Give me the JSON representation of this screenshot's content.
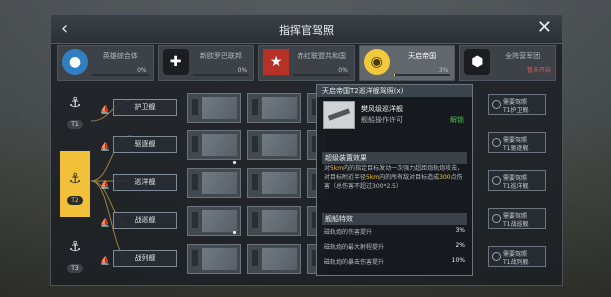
{
  "header": {
    "title": "指挥官驾照",
    "back_icon": "‹",
    "close_icon": "✕"
  },
  "tabs": [
    {
      "name": "英雄综合体",
      "pct": "0%",
      "icon": "●",
      "icon_name": "blue-circle-icon",
      "color": "blue",
      "active": false
    },
    {
      "name": "新欧罗巴联邦",
      "pct": "0%",
      "icon": "✚",
      "icon_name": "cross-emblem-icon",
      "color": "dark",
      "active": false
    },
    {
      "name": "赤红联盟共和国",
      "pct": "0%",
      "icon": "★",
      "icon_name": "red-star-icon",
      "color": "red",
      "active": false
    },
    {
      "name": "天启帝国",
      "pct": "3%",
      "fill": 0.03,
      "icon": "◉",
      "icon_name": "gold-emblem-icon",
      "color": "gold",
      "active": true
    },
    {
      "name": "全阵营军团",
      "pct": "0%",
      "icon": "⬢",
      "icon_name": "hex-emblem-icon",
      "color": "dark",
      "active": false,
      "lock": "暂未开启"
    }
  ],
  "tiers": [
    {
      "label": "T1",
      "icon": "⚓"
    },
    {
      "label": "T2",
      "icon": "⚓",
      "active": true
    },
    {
      "label": "T3",
      "icon": "⚓"
    }
  ],
  "ships": [
    "护卫舰",
    "驱逐舰",
    "巡洋舰",
    "战巡舰",
    "战列舰"
  ],
  "detail": {
    "header": "天启帝国T2巡洋舰驾照(x)",
    "item_name": "樊风级巡洋舰",
    "item_sub": "舰船操作许可",
    "item_state": "解锁",
    "section1": "超级装置效果",
    "effect_pre": "对",
    "effect_hl1": "5km",
    "effect_mid": "内的指定目标发动一次强力超距炮轨炮攻击，对目标附近半径",
    "effect_hl2": "5km",
    "effect_mid2": "内的所有敌对目标造成",
    "effect_hl3": "300",
    "effect_post": "点伤害（总伤害不超过300*2.5）",
    "section2": "舰船特效",
    "rows": [
      {
        "label": "磁轨炮的伤害提升",
        "value": "3%"
      },
      {
        "label": "磁轨炮的最大射程提升",
        "value": "2%"
      },
      {
        "label": "磁轨炮的暴击伤害提升",
        "value": "10%"
      }
    ]
  },
  "requirements": [
    {
      "l1": "需要驾照",
      "l2": "T1护卫舰"
    },
    {
      "l1": "需要驾照",
      "l2": "T1驱逐舰"
    },
    {
      "l1": "需要驾照",
      "l2": "T1巡洋舰"
    },
    {
      "l1": "需要驾照",
      "l2": "T1战巡舰"
    },
    {
      "l1": "需要驾照",
      "l2": "T1战列舰"
    }
  ]
}
